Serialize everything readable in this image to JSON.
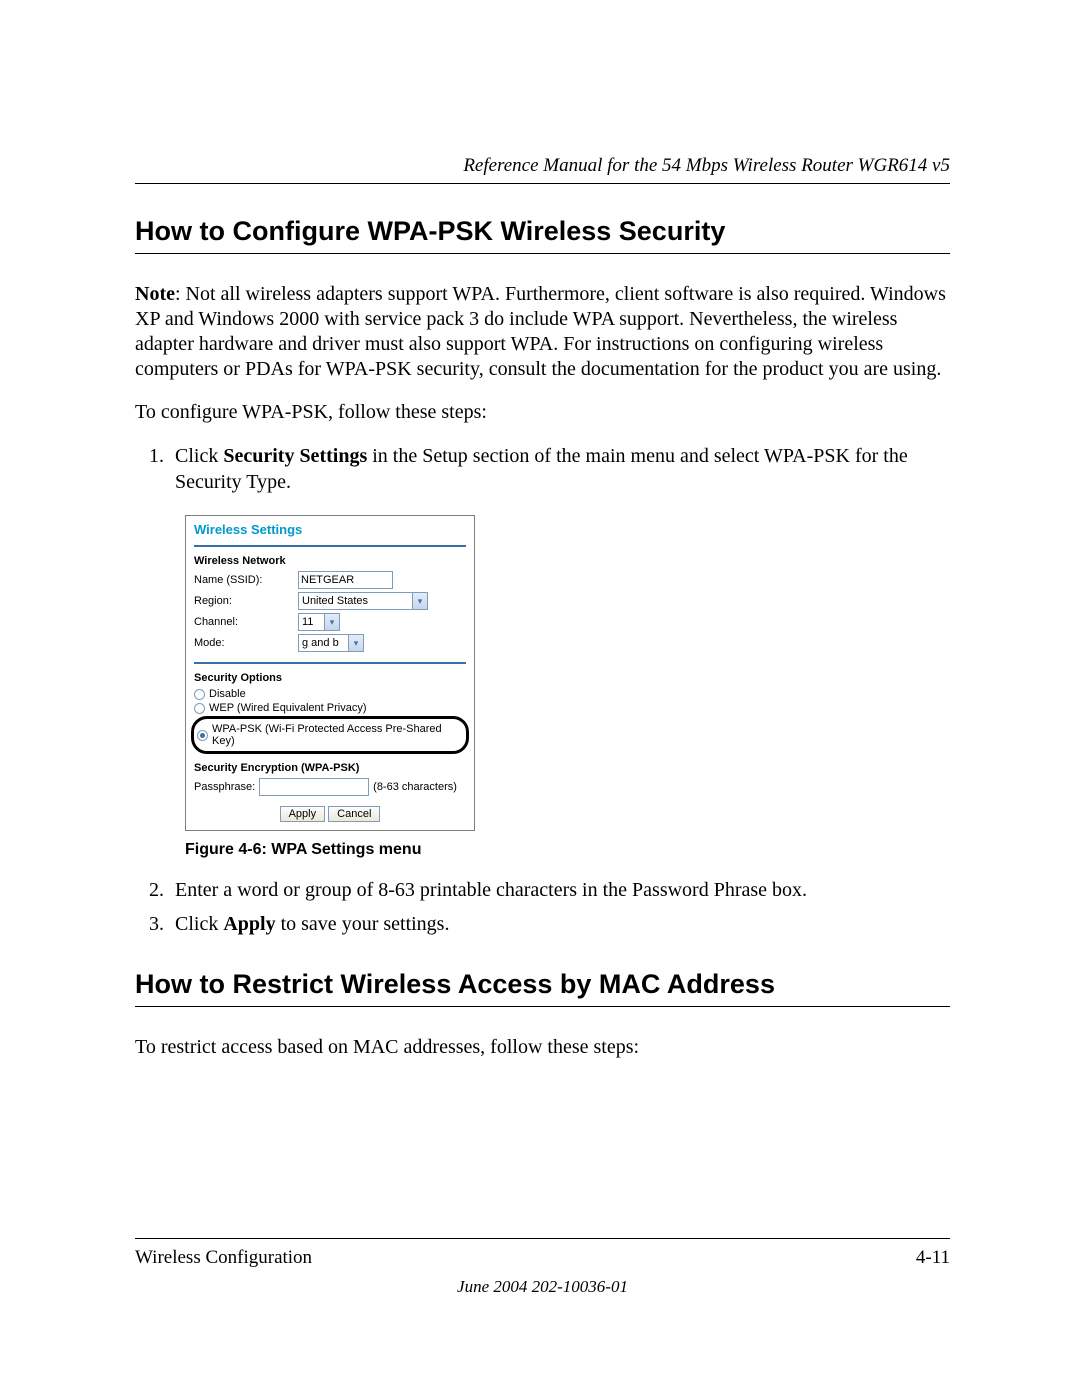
{
  "header": {
    "title": "Reference Manual for the 54 Mbps Wireless Router WGR614 v5"
  },
  "section1": {
    "heading": "How to Configure WPA-PSK Wireless Security",
    "note_label": "Note",
    "note_body": ": Not all wireless adapters support WPA. Furthermore, client software is also required. Windows XP and Windows 2000 with service pack 3 do include WPA support. Nevertheless, the wireless adapter hardware and driver must also support WPA. For instructions on configuring wireless computers or PDAs for WPA-PSK security, consult the documentation for the product you are using.",
    "intro": "To configure WPA-PSK, follow these steps:",
    "step1_a": "Click ",
    "step1_bold": "Security Settings",
    "step1_b": " in the Setup section of the main menu and select WPA-PSK for the Security Type.",
    "step2": "Enter a word or group of 8-63 printable characters in the Password Phrase box.",
    "step3_a": "Click ",
    "step3_bold": "Apply",
    "step3_b": " to save your settings."
  },
  "figure": {
    "caption": "Figure 4-6: WPA Settings menu",
    "panel_title": "Wireless Settings",
    "network_heading": "Wireless Network",
    "name_label": "Name (SSID):",
    "name_value": "NETGEAR",
    "region_label": "Region:",
    "region_value": "United States",
    "channel_label": "Channel:",
    "channel_value": "11",
    "mode_label": "Mode:",
    "mode_value": "g and b",
    "security_heading": "Security Options",
    "opt_disable": "Disable",
    "opt_wep": "WEP (Wired Equivalent Privacy)",
    "opt_wpa": "WPA-PSK (Wi-Fi Protected Access Pre-Shared Key)",
    "enc_heading": "Security Encryption (WPA-PSK)",
    "pass_label": "Passphrase:",
    "pass_hint": "(8-63 characters)",
    "apply": "Apply",
    "cancel": "Cancel"
  },
  "section2": {
    "heading": "How to Restrict Wireless Access by MAC Address",
    "intro": "To restrict access based on MAC addresses, follow these steps:"
  },
  "footer": {
    "left": "Wireless Configuration",
    "right": "4-11",
    "date": "June 2004 202-10036-01"
  }
}
